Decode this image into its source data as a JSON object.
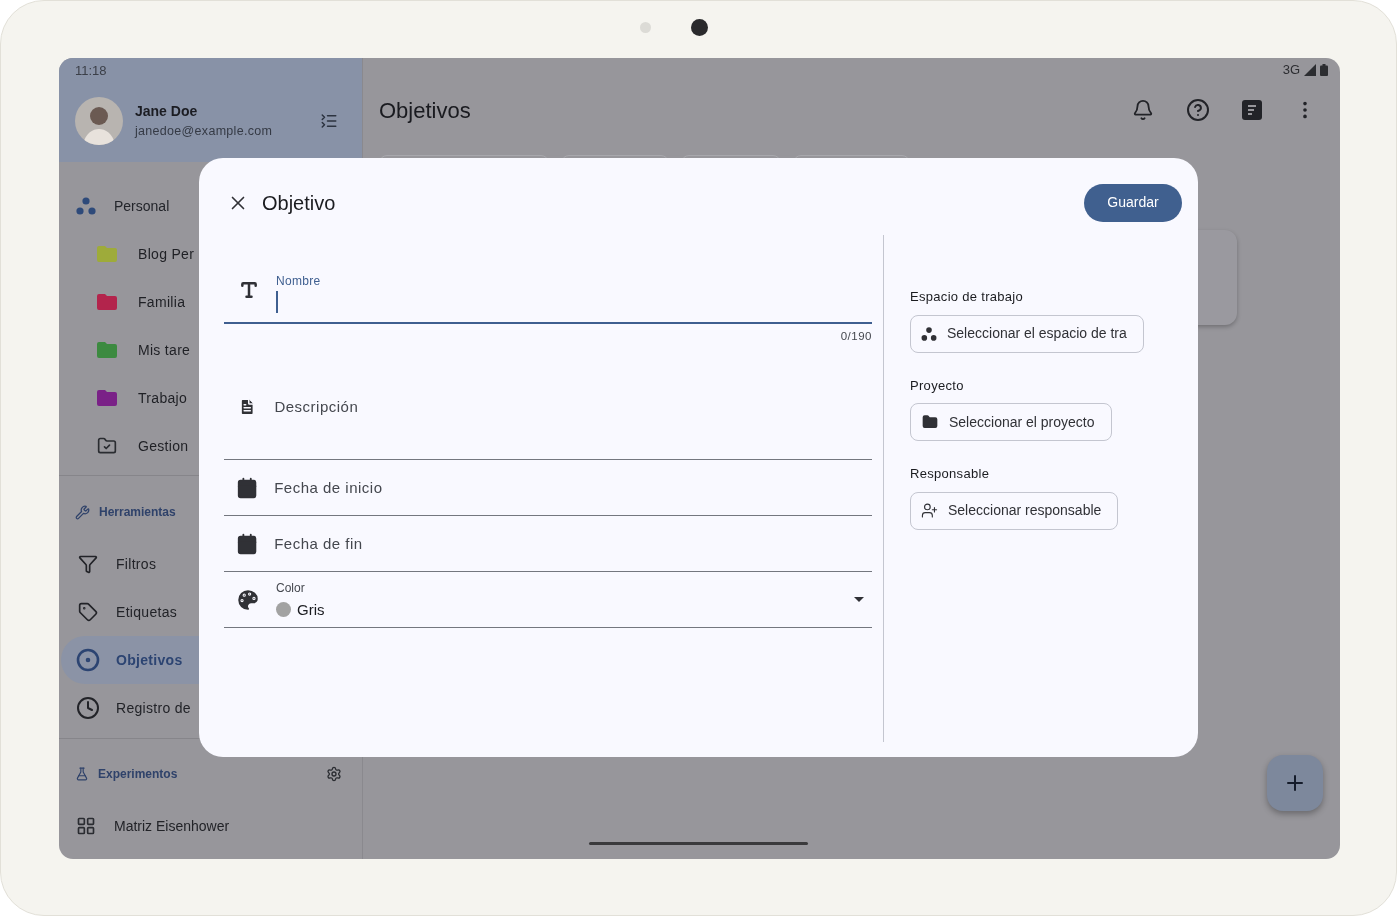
{
  "status_bar": {
    "time": "11:18",
    "network": "3G"
  },
  "user": {
    "name": "Jane Doe",
    "email": "janedoe@example.com"
  },
  "sidebar": {
    "workspace": {
      "label": "Personal"
    },
    "items": [
      {
        "kind": "folder",
        "label": "Blog Per",
        "color": "#9eab3a"
      },
      {
        "kind": "folder",
        "label": "Familia",
        "color": "#b3244c"
      },
      {
        "kind": "folder",
        "label": "Mis tare",
        "color": "#3c8a40"
      },
      {
        "kind": "folder",
        "label": "Trabajo",
        "color": "#7a2187"
      },
      {
        "kind": "manage",
        "label": "Gestion"
      }
    ],
    "tools": {
      "title": "Herramientas",
      "items": [
        {
          "kind": "filter",
          "label": "Filtros",
          "selected": false
        },
        {
          "kind": "tag",
          "label": "Etiquetas",
          "selected": false
        },
        {
          "kind": "target",
          "label": "Objetivos",
          "selected": true
        },
        {
          "kind": "clock",
          "label": "Registro de",
          "selected": false
        }
      ]
    },
    "experiments": {
      "title": "Experimentos",
      "items": [
        {
          "label": "Matriz Eisenhower"
        }
      ]
    }
  },
  "page": {
    "title": "Objetivos"
  },
  "dialog": {
    "title": "Objetivo",
    "save": "Guardar",
    "fields": [
      {
        "kind": "text",
        "label": "Nombre",
        "focused": true,
        "counter": "0/190"
      },
      {
        "kind": "multiline",
        "placeholder": "Descripción"
      },
      {
        "kind": "date",
        "placeholder": "Fecha de inicio"
      },
      {
        "kind": "date",
        "placeholder": "Fecha de fin"
      },
      {
        "kind": "select",
        "label": "Color",
        "value": "Gris",
        "color": "#a2a2a2"
      }
    ],
    "pickers": [
      {
        "kind": "workspace",
        "label": "Espacio de trabajo",
        "button": "Seleccionar el espacio de tra"
      },
      {
        "kind": "project",
        "label": "Proyecto",
        "button": "Seleccionar el proyecto"
      },
      {
        "kind": "person",
        "label": "Responsable",
        "button": "Seleccionar responsable"
      }
    ]
  }
}
